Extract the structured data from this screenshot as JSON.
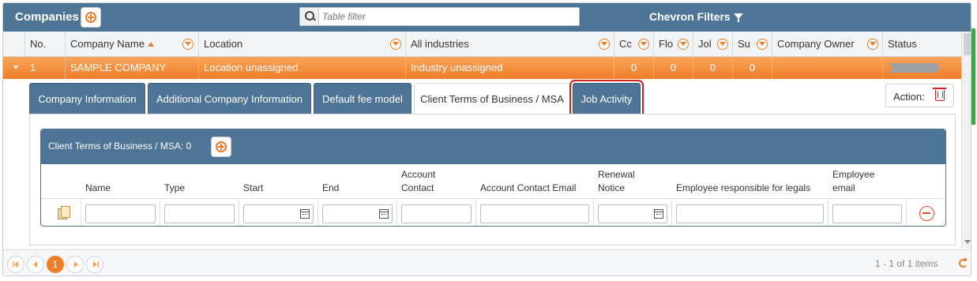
{
  "header": {
    "title": "Companies",
    "search_placeholder": "Table filter",
    "chevron_filters": "Chevron Filters"
  },
  "columns": [
    "No.",
    "Company Name",
    "Location",
    "All industries",
    "Cc",
    "Flo",
    "Jol",
    "Su",
    "Company Owner",
    "Status"
  ],
  "row": {
    "no": "1",
    "company_name": "SAMPLE COMPANY",
    "location": "Location unassigned",
    "industry": "Industry unassigned",
    "cc": "0",
    "flo": "0",
    "jol": "0",
    "su": "0",
    "status_chevrons": 4
  },
  "tabs": [
    {
      "label": "Company Information",
      "active": false
    },
    {
      "label": "Additional Company Information",
      "active": false
    },
    {
      "label": "Default fee model",
      "active": false
    },
    {
      "label": "Client Terms of Business / MSA",
      "active": true
    },
    {
      "label": "Job Activity",
      "active": false,
      "highlighted": true
    }
  ],
  "action": {
    "label": "Action:"
  },
  "subpanel": {
    "title": "Client Terms of Business / MSA: 0",
    "columns": [
      "Name",
      "Type",
      "Start",
      "End",
      "Account Contact",
      "Account Contact Email",
      "Renewal Notice",
      "Employee responsible for legals",
      "Employee email"
    ]
  },
  "footer": {
    "current_page": "1",
    "items_text": "1 - 1 of 1 items"
  },
  "colors": {
    "header_blue": "#4f7596",
    "accent_orange": "#ef7d27",
    "highlight_red": "#d62020"
  }
}
